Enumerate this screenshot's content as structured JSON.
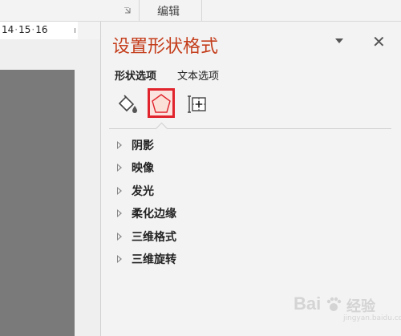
{
  "ribbon": {
    "group_label": "编辑"
  },
  "ruler": {
    "marks": [
      "14",
      "15",
      "16"
    ]
  },
  "pane": {
    "title": "设置形状格式",
    "tabs": [
      {
        "label": "形状选项",
        "active": true
      },
      {
        "label": "文本选项",
        "active": false
      }
    ],
    "category_icons": [
      "fill-line-icon",
      "effects-pentagon-icon",
      "size-properties-icon"
    ],
    "selected_category": "effects-pentagon-icon",
    "sections": [
      {
        "label": "阴影"
      },
      {
        "label": "映像"
      },
      {
        "label": "发光"
      },
      {
        "label": "柔化边缘"
      },
      {
        "label": "三维格式"
      },
      {
        "label": "三维旋转"
      }
    ]
  },
  "watermark": {
    "text": "Bai",
    "text2": "经验",
    "sub": "jingyan.baidu.com"
  },
  "colors": {
    "title": "#c43e1c",
    "highlight": "#e0232c",
    "slide_bg": "#7a7a7a"
  }
}
